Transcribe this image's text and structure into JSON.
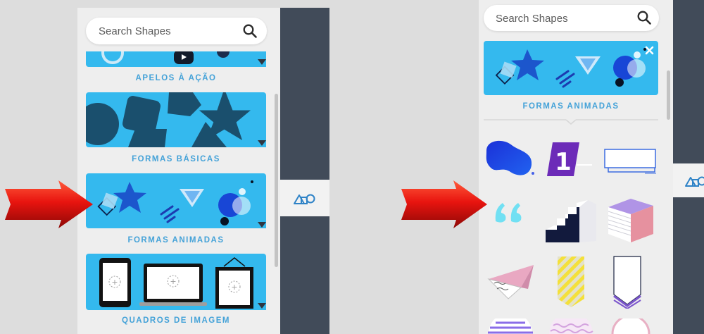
{
  "left": {
    "search": {
      "placeholder": "Search Shapes",
      "icon": "search-icon"
    },
    "categories": [
      {
        "label": "APELOS À AÇÃO"
      },
      {
        "label": "FORMAS BÁSICAS"
      },
      {
        "label": "FORMAS ANIMADAS"
      },
      {
        "label": "QUADROS DE IMAGEM"
      }
    ]
  },
  "right": {
    "search": {
      "placeholder": "Search Shapes",
      "icon": "search-icon"
    },
    "selected_category": {
      "label": "FORMAS ANIMADAS",
      "close_icon": "close-icon"
    }
  },
  "icons": {
    "shapes_tab": "shapes-tab-icon",
    "annotation": "red-arrow"
  },
  "colors": {
    "card_bg": "#34b9ee",
    "label": "#44a2d8",
    "dark_rail": "#414b59",
    "panel_bg": "#eeeeee",
    "arrow_red": "#e8140f"
  }
}
